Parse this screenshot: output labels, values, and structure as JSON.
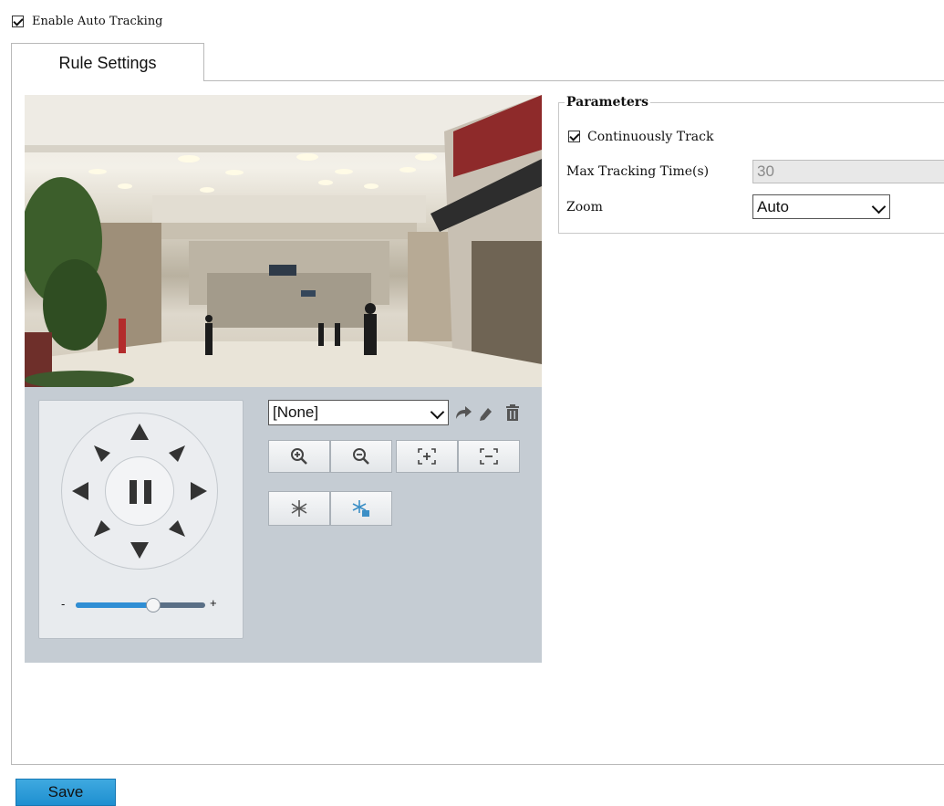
{
  "enable_auto_tracking": {
    "label": "Enable Auto Tracking",
    "checked": true
  },
  "tabs": [
    {
      "label": "Rule Settings",
      "active": true
    }
  ],
  "ptz": {
    "preset_select": {
      "value": "[None]"
    },
    "preset_icons": [
      "go-to-preset-icon",
      "edit-preset-icon",
      "delete-preset-icon"
    ],
    "zoom_buttons": [
      "zoom-in-icon",
      "zoom-out-icon",
      "focus-near-icon",
      "focus-far-icon"
    ],
    "extra_buttons": [
      "iris-icon",
      "focus-auto-icon"
    ],
    "speed": {
      "minus": "-",
      "plus": "+",
      "value": 0.6
    }
  },
  "parameters": {
    "legend": "Parameters",
    "continuously_track": {
      "label": "Continuously Track",
      "checked": true
    },
    "max_tracking_time": {
      "label": "Max Tracking Time(s)",
      "value": "30"
    },
    "zoom": {
      "label": "Zoom",
      "value": "Auto"
    }
  },
  "save_label": "Save",
  "colors": {
    "ptz_background": "#c5ccd3",
    "save_button": "#2b9ad6",
    "icon_gray": "#555555",
    "icon_blue": "#3c8fc6"
  }
}
